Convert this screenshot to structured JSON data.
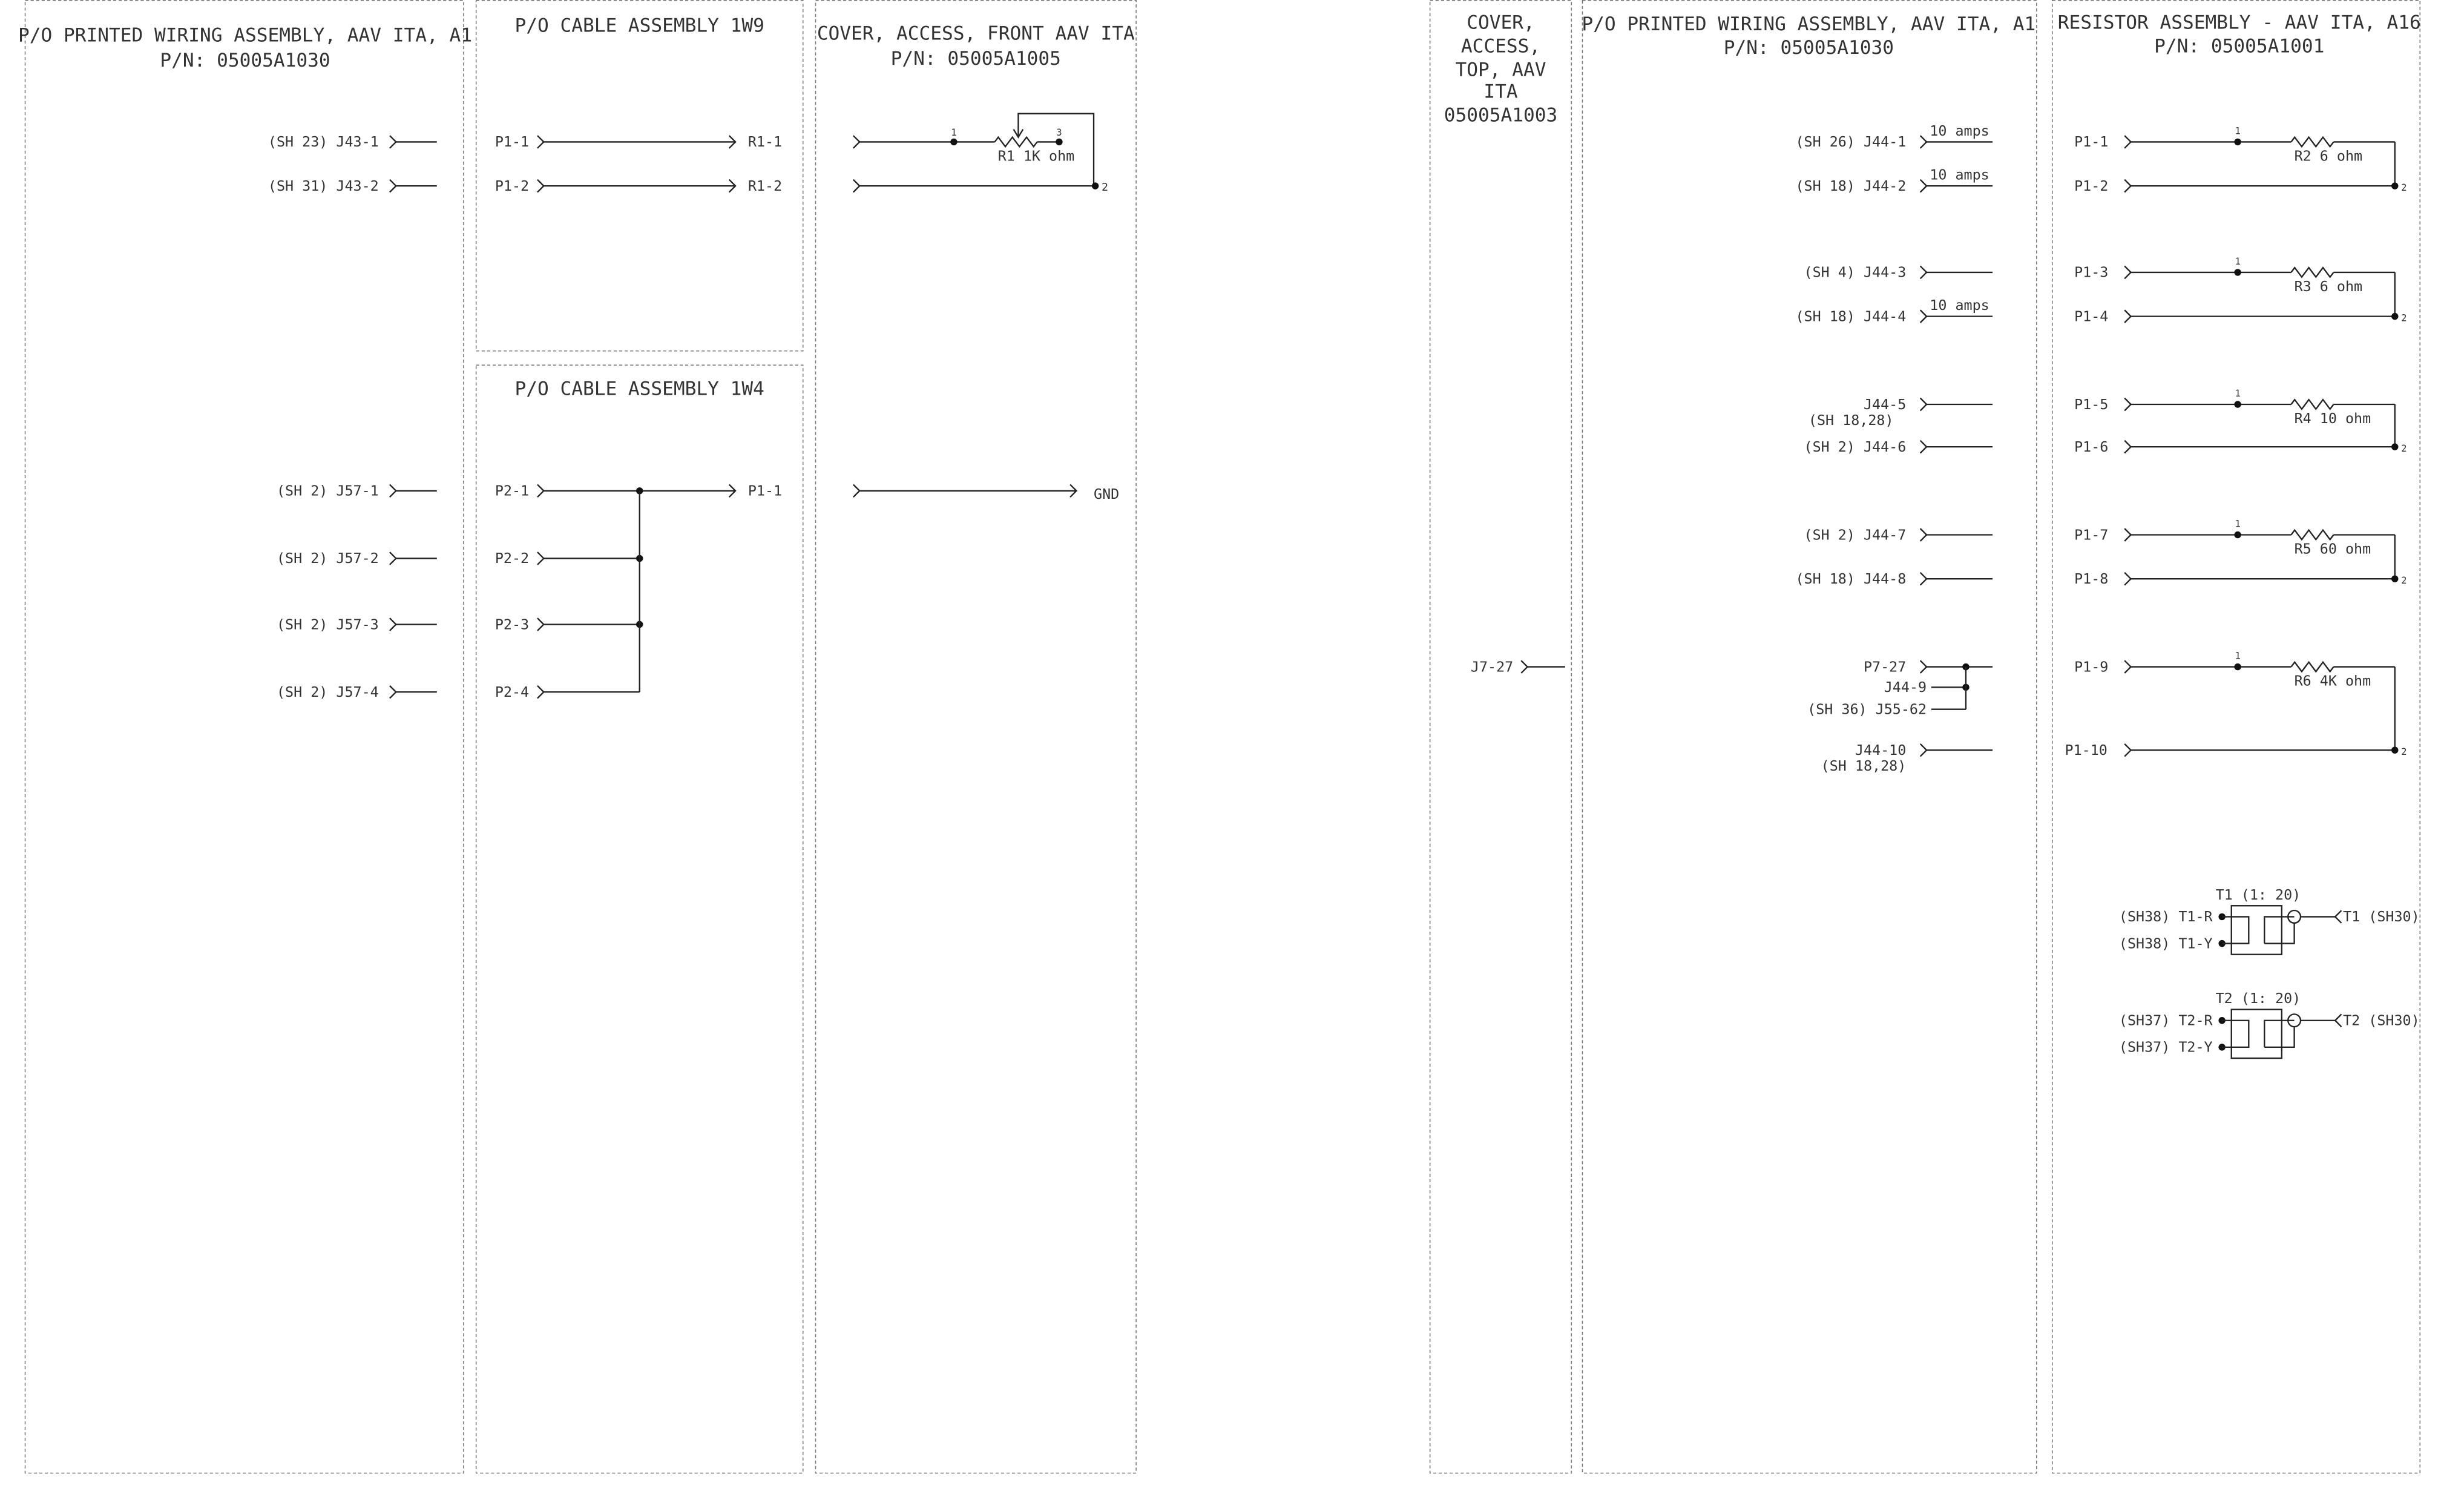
{
  "panel_a": {
    "title": [
      "P/O PRINTED WIRING ASSEMBLY, AAV ITA, A1",
      "P/N: 05005A1030"
    ],
    "pins": [
      "(SH 23) J43-1",
      "(SH 31) J43-2",
      "(SH 2) J57-1",
      "(SH 2) J57-2",
      "(SH 2) J57-3",
      "(SH 2) J57-4"
    ]
  },
  "panel_b1": {
    "title": "P/O CABLE ASSEMBLY 1W9",
    "wires": [
      {
        "from": "P1-1",
        "to": "R1-1"
      },
      {
        "from": "P1-2",
        "to": "R1-2"
      }
    ]
  },
  "panel_b2": {
    "title": "P/O CABLE ASSEMBLY 1W4",
    "pins": [
      "P2-1",
      "P2-2",
      "P2-3",
      "P2-4"
    ],
    "to": "P1-1"
  },
  "panel_c": {
    "title": [
      "COVER, ACCESS, FRONT AAV ITA",
      "P/N: 05005A1005"
    ],
    "resistor": "R1 1K ohm",
    "node1": "1",
    "node2": "2",
    "node3": "3",
    "gnd": "GND"
  },
  "panel_d": {
    "title": [
      "COVER,",
      "ACCESS,",
      "TOP, AAV",
      "ITA",
      "05005A1003"
    ],
    "pin": "J7-27"
  },
  "panel_e": {
    "title": [
      "P/O PRINTED WIRING ASSEMBLY, AAV ITA, A1",
      "P/N: 05005A1030"
    ],
    "pins": [
      {
        "label": "(SH 26) J44-1",
        "note": "10 amps"
      },
      {
        "label": "(SH 18) J44-2",
        "note": "10 amps"
      },
      {
        "label": "(SH 4) J44-3"
      },
      {
        "label": "(SH 18) J44-4",
        "note": "10 amps"
      },
      {
        "label": "J44-5",
        "sub": "(SH 18,28)"
      },
      {
        "label": "(SH 2) J44-6"
      },
      {
        "label": "(SH 2) J44-7"
      },
      {
        "label": "(SH 18) J44-8"
      },
      {
        "label": "P7-27"
      },
      {
        "label": "J44-9"
      },
      {
        "label": "(SH 36) J55-62"
      },
      {
        "label": "J44-10",
        "sub": "(SH 18,28)"
      }
    ]
  },
  "panel_f": {
    "title": [
      "RESISTOR ASSEMBLY - AAV ITA, A16",
      "P/N: 05005A1001"
    ],
    "resistors": [
      {
        "in": "P1-1",
        "out": "P1-2",
        "label": "R2 6 ohm"
      },
      {
        "in": "P1-3",
        "out": "P1-4",
        "label": "R3 6 ohm"
      },
      {
        "in": "P1-5",
        "out": "P1-6",
        "label": "R4 10 ohm"
      },
      {
        "in": "P1-7",
        "out": "P1-8",
        "label": "R5 60 ohm"
      },
      {
        "in": "P1-9",
        "out": "P1-10",
        "label": "R6 4K ohm"
      }
    ],
    "node1": "1",
    "node2": "2",
    "transformers": [
      {
        "name": "T1 (1: 20)",
        "r": "(SH38) T1-R",
        "y": "(SH38) T1-Y",
        "out": "T1 (SH30)"
      },
      {
        "name": "T2 (1: 20)",
        "r": "(SH37) T2-R",
        "y": "(SH37) T2-Y",
        "out": "T2 (SH30)"
      }
    ]
  }
}
